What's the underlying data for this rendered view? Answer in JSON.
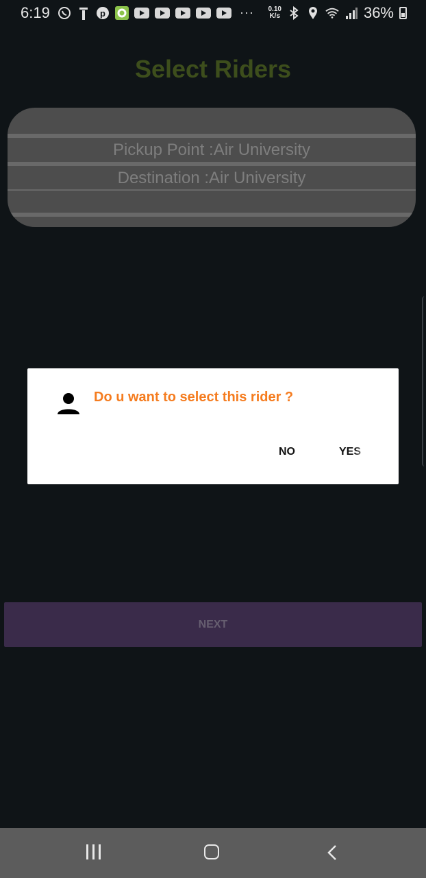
{
  "status_bar": {
    "time": "6:19",
    "net_speed_value": "0.10",
    "net_speed_unit": "K/s",
    "battery_percent": "36%",
    "overflow": "···"
  },
  "page": {
    "title": "Select Riders"
  },
  "card": {
    "pickup": "Pickup Point :Air University",
    "destination": "Destination :Air University"
  },
  "dialog": {
    "message": "Do u want to select this rider ?",
    "no_label": "NO",
    "yes_label": "YES"
  },
  "actions": {
    "next_label": "NEXT"
  },
  "colors": {
    "title": "#3d4e1c",
    "dialog_message": "#f57c1f",
    "next_bg": "#3a2b4a"
  }
}
